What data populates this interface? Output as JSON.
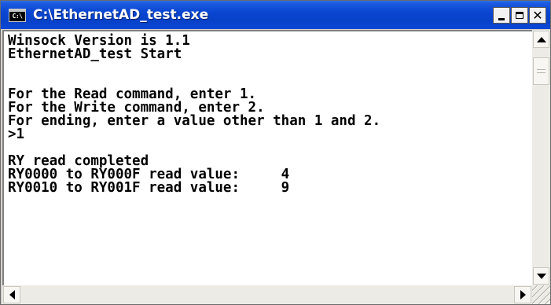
{
  "window": {
    "title": "C:\\EthernetAD_test.exe",
    "icon_label": "C:\\",
    "system_icon": "console-icon",
    "controls": {
      "minimize_icon": "minimize-icon",
      "maximize_icon": "maximize-icon",
      "close_icon": "close-icon"
    }
  },
  "console": {
    "lines": [
      "Winsock Version is 1.1",
      "EthernetAD_test Start",
      "",
      "",
      "For the Read command, enter 1.",
      "For the Write command, enter 2.",
      "For ending, enter a value other than 1 and 2.",
      ">1",
      "",
      "RY read completed",
      "RY0000 to RY000F read value:     4",
      "RY0010 to RY001F read value:     9"
    ]
  },
  "colors": {
    "titlebar": "#0a46d2",
    "title_text": "#ffffff",
    "console_bg": "#ffffff",
    "console_text": "#000000"
  }
}
